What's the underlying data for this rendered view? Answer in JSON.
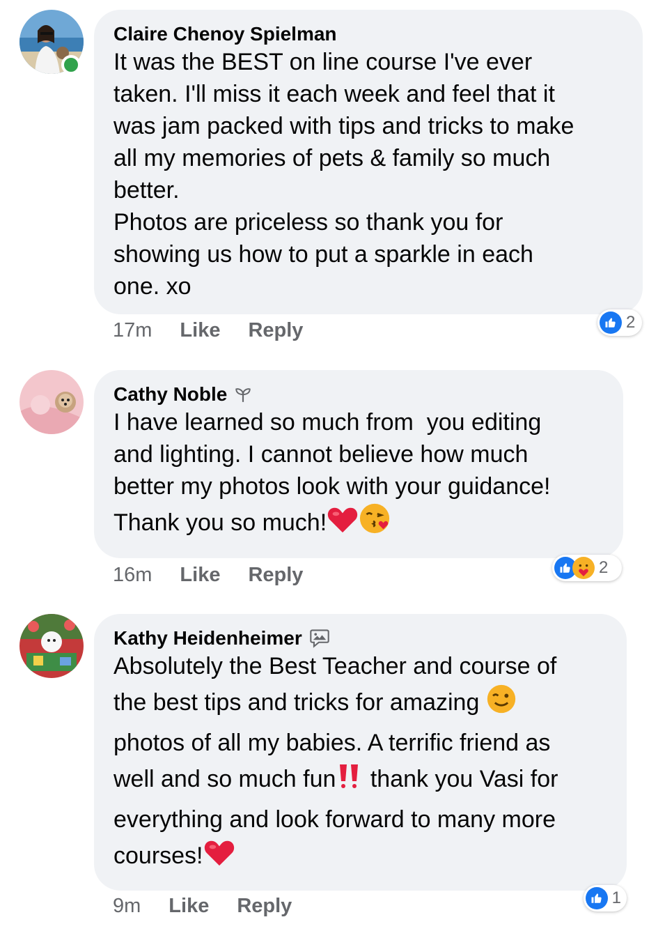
{
  "colors": {
    "bubble_bg": "#f0f2f5",
    "meta_text": "#65676b",
    "like_blue": "#1877f2",
    "online_green": "#31a24c",
    "heart_red": "#e41e3f"
  },
  "comments": [
    {
      "author": "Claire Chenoy Spielman",
      "badge_icon": "",
      "online": true,
      "text": "It was the BEST on line course I've ever\ntaken. I'll miss it each week and feel that it\nwas jam packed with tips and tricks to make\nall my memories of pets & family so much\nbetter.\nPhotos are priceless so thank you for\nshowing us how to put a sparkle in each\none. xo",
      "time": "17m",
      "like_label": "Like",
      "reply_label": "Reply",
      "reaction_icons": [
        "like-icon"
      ],
      "reaction_count": "2"
    },
    {
      "author": "Cathy Noble",
      "badge_icon": "sprout-icon",
      "online": false,
      "text": "I have learned so much from  you editing\nand lighting. I cannot believe how much\nbetter my photos look with your guidance!\nThank you so much!",
      "time": "16m",
      "like_label": "Like",
      "reply_label": "Reply",
      "reaction_icons": [
        "like-icon",
        "care-icon"
      ],
      "reaction_count": "2"
    },
    {
      "author": "Kathy Heidenheimer",
      "badge_icon": "photo-message-icon",
      "online": false,
      "text": "Absolutely the Best Teacher and course of\nthe best tips and tricks for amazing\nphotos of all my babies. A terrific friend as\nwell and so much fun\nthank you Vasi for\neverything and look forward to many more\ncourses!",
      "text_parts": {
        "line1": "Absolutely the Best Teacher and course of",
        "line2": "the best tips and tricks for amazing",
        "line3": "photos of all my babies. A terrific friend as",
        "line4a": "well and so much fun",
        "line4b": " thank you Vasi for",
        "line5": "everything and look forward to many more",
        "line6": "courses!"
      },
      "time": "9m",
      "like_label": "Like",
      "reply_label": "Reply",
      "reaction_icons": [
        "like-icon"
      ],
      "reaction_count": "1"
    }
  ]
}
